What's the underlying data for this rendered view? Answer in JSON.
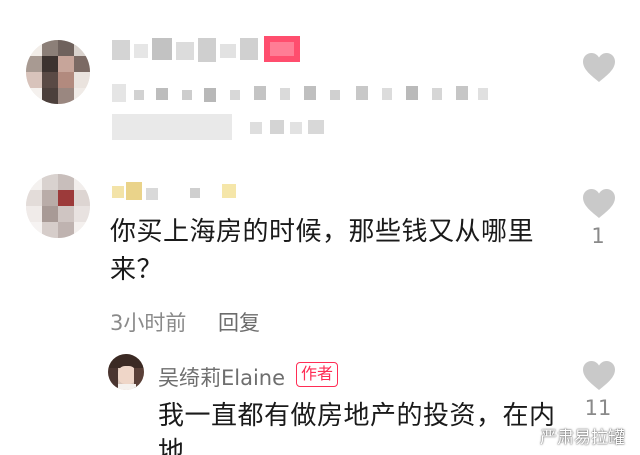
{
  "comments": [
    {
      "username": "",
      "text": "",
      "like_count": "",
      "liked": false
    },
    {
      "username": "",
      "text_line1": "你买上海房的时候，那些钱又从哪里",
      "text_line2": "来？",
      "time": "3小时前",
      "reply_label": "回复",
      "like_count": "1"
    }
  ],
  "reply": {
    "username": "吴绮莉Elaine",
    "badge": "作者",
    "text_line1": "我一直都有做房地产的投资，在内",
    "text_line2": "地",
    "like_count": "11"
  },
  "watermark": "严肃易拉罐",
  "colors": {
    "accent": "#ff2d55",
    "like_icon": "#c9c9c9",
    "meta_text": "#8a8a8a"
  },
  "icons": {
    "like": "heart-icon"
  }
}
